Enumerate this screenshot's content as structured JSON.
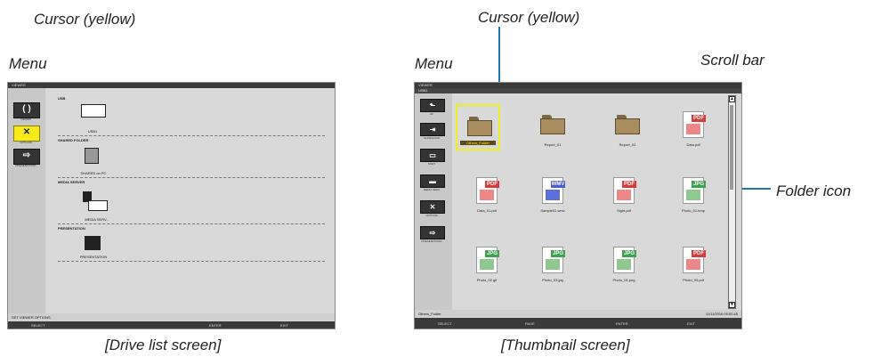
{
  "captions": {
    "cursor_left": "Cursor (yellow)",
    "menu_left": "Menu",
    "cursor_right": "Cursor (yellow)",
    "menu_right": "Menu",
    "scroll_bar": "Scroll bar",
    "folder_icon": "Folder icon",
    "drive_list_screen": "[Drive list screen]",
    "thumbnail_screen": "[Thumbnail screen]"
  },
  "colors": {
    "cursor": "#f6ea1c",
    "leader_line": "#1f77b4",
    "pdf": "#d93a3a",
    "wmv": "#4b5fc8",
    "jpg": "#3fa34d"
  },
  "drive_screen": {
    "title": "VIEWER",
    "menu": [
      {
        "icon": "viewer-icon",
        "glyph": "( )",
        "label": "VIEWER"
      },
      {
        "icon": "option-icon",
        "glyph": "✕",
        "label": "OPTIONS",
        "selected": true
      },
      {
        "icon": "presentation-icon",
        "glyph": "⇨",
        "label": "PRESENTATION"
      }
    ],
    "sections": [
      {
        "heading": "USB",
        "label": "USB1"
      },
      {
        "heading": "SHARED FOLDER",
        "label": "SHARED on PC"
      },
      {
        "heading": "MEDIA SERVER",
        "label": "MEDIA SERV..."
      },
      {
        "heading": "PRESENTATION",
        "label": "PRESENTATION"
      }
    ],
    "info": "SET VIEWER OPTIONS.",
    "bottom": {
      "select": "SELECT",
      "enter": "ENTER",
      "exit": "EXIT"
    }
  },
  "thumb_screen": {
    "title": "VIEWER",
    "path": "USB1",
    "menu": [
      {
        "icon": "up-folder-icon",
        "glyph": "⬑",
        "label": "UP"
      },
      {
        "icon": "slideshow-icon",
        "glyph": "⇥",
        "label": "SLIDESHOW"
      },
      {
        "icon": "sort-icon",
        "glyph": "▭",
        "label": "SORT"
      },
      {
        "icon": "media-server-icon",
        "glyph": "▬",
        "label": "MEDIA SERV"
      },
      {
        "icon": "option-icon",
        "glyph": "✕",
        "label": "OPTIONS"
      },
      {
        "icon": "presentation-icon",
        "glyph": "⇨",
        "label": "PRESENTATION"
      }
    ],
    "items": [
      {
        "kind": "folder",
        "label": "Others_Folder",
        "selected": true
      },
      {
        "kind": "folder",
        "label": "Report_01"
      },
      {
        "kind": "folder",
        "label": "Report_02"
      },
      {
        "kind": "pdf",
        "label": "Data.pdf"
      },
      {
        "kind": "pdf",
        "label": "Data_01.pdf"
      },
      {
        "kind": "wmv",
        "label": "Sample01.wmv"
      },
      {
        "kind": "pdf",
        "label": "Sight.pdf"
      },
      {
        "kind": "jpg",
        "label": "Photo_01.bmp"
      },
      {
        "kind": "jpg",
        "label": "Photo_02.gif"
      },
      {
        "kind": "jpg",
        "label": "Photo_03.jpg"
      },
      {
        "kind": "jpg",
        "label": "Photo_04.png"
      },
      {
        "kind": "pdf",
        "label": "Photo_05.pdf"
      }
    ],
    "badges": {
      "pdf": "PDF",
      "wmv": "WMV",
      "jpg": "JPG"
    },
    "info_left": "Others_Folder",
    "info_right": "11/11/2016 09:00:45",
    "bottom": {
      "select": "SELECT",
      "page": "PAGE",
      "enter": "ENTER",
      "exit": "EXIT"
    }
  }
}
